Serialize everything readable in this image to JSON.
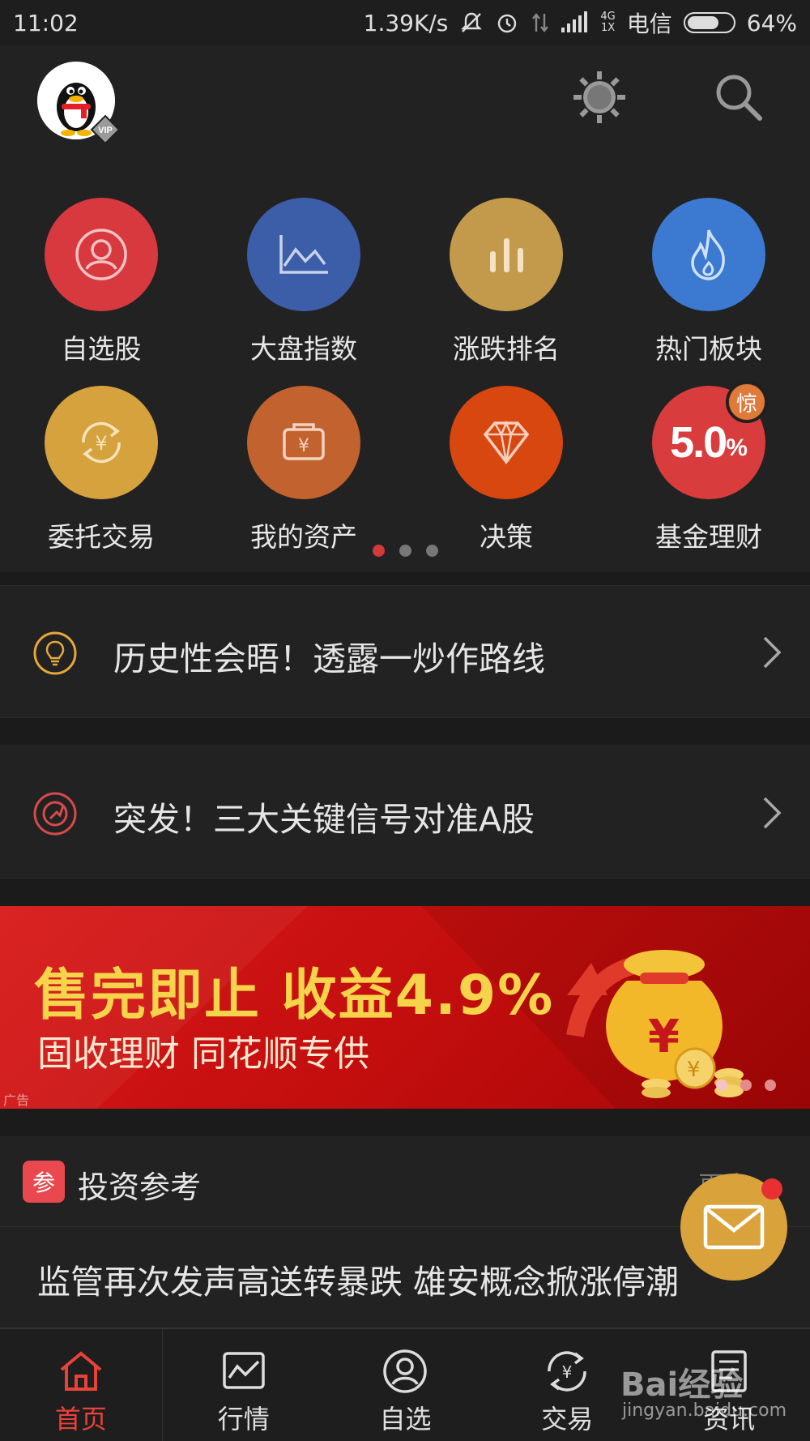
{
  "status_bar": {
    "time": "11:02",
    "net_speed": "1.39K/s",
    "net_type_top": "4G",
    "net_type_bottom": "1X",
    "carrier": "电信",
    "battery": "64%"
  },
  "header": {
    "vip_label": "VIP"
  },
  "grid": {
    "items": [
      {
        "label": "自选股",
        "color": "#d8393f"
      },
      {
        "label": "大盘指数",
        "color": "#3c5da8"
      },
      {
        "label": "涨跌排名",
        "color": "#c39a4b"
      },
      {
        "label": "热门板块",
        "color": "#3b7ad0"
      },
      {
        "label": "委托交易",
        "color": "#d5a23e"
      },
      {
        "label": "我的资产",
        "color": "#c2622f"
      },
      {
        "label": "决策",
        "color": "#d8470f"
      },
      {
        "label": "基金理财",
        "color": "#d93c3c"
      }
    ],
    "fund_rate": "5.0",
    "fund_rate_unit": "%",
    "fund_badge": "惊",
    "page_count": 3,
    "page_active": 1
  },
  "news": [
    {
      "text": "历史性会晤！透露一炒作路线"
    },
    {
      "text": "突发！三大关键信号对准A股"
    }
  ],
  "banner": {
    "line1": "售完即止  收益4.9%",
    "line2": "固收理财   同花顺专供",
    "ad_label": "广告"
  },
  "reference": {
    "icon_label": "参",
    "title": "投资参考",
    "more": "更多",
    "headline": "监管再次发声高送转暴跌 雄安概念掀涨停潮"
  },
  "bottom_nav": [
    {
      "label": "首页",
      "active": true
    },
    {
      "label": "行情",
      "active": false
    },
    {
      "label": "自选",
      "active": false
    },
    {
      "label": "交易",
      "active": false
    },
    {
      "label": "资讯",
      "active": false
    }
  ],
  "watermark": {
    "brand": "Bai经验",
    "url": "jingyan.baidu.com"
  },
  "colors": {
    "accent": "#e8423a",
    "background": "#222222"
  }
}
